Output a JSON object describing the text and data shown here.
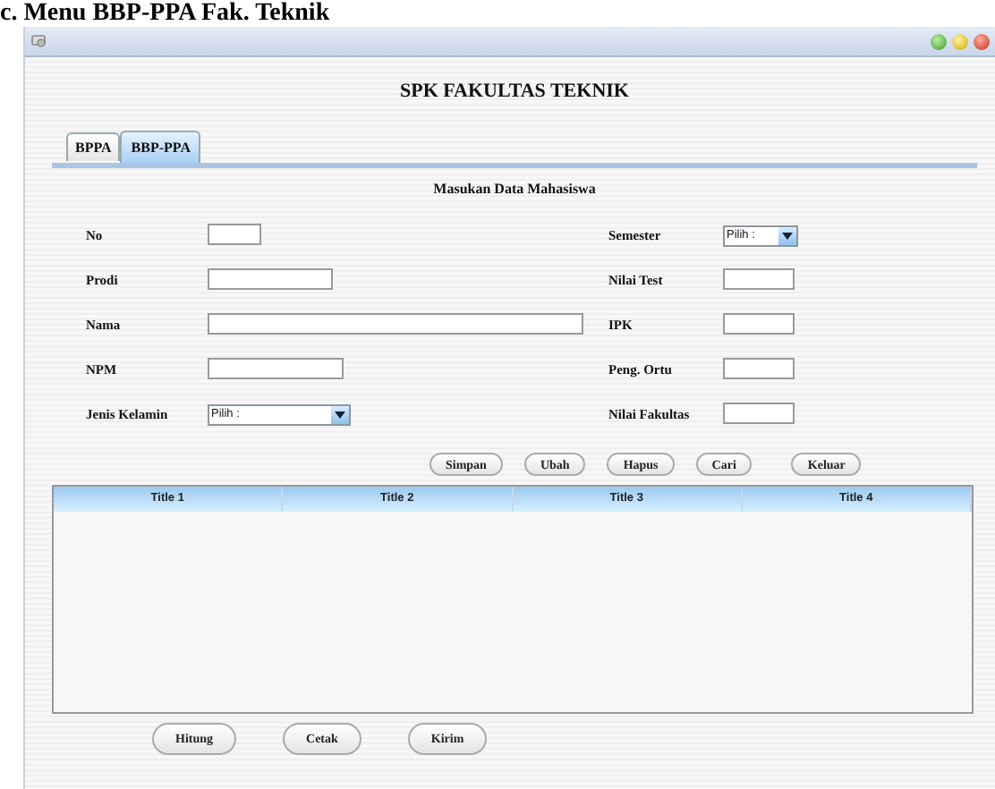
{
  "caption": "c. Menu BBP-PPA Fak. Teknik",
  "window": {
    "title": "SPK FAKULTAS TEKNIK"
  },
  "tabs": [
    {
      "label": "BPPA",
      "selected": false
    },
    {
      "label": "BBP-PPA",
      "selected": true
    }
  ],
  "section_title": "Masukan Data Mahasiswa",
  "fields_left": [
    {
      "label": "No",
      "kind": "text"
    },
    {
      "label": "Prodi",
      "kind": "text"
    },
    {
      "label": "Nama",
      "kind": "text"
    },
    {
      "label": "NPM",
      "kind": "text"
    },
    {
      "label": "Jenis Kelamin",
      "kind": "select",
      "value": "Pilih :"
    }
  ],
  "fields_right": [
    {
      "label": "Semester",
      "kind": "select",
      "value": "Pilih :"
    },
    {
      "label": "Nilai Test",
      "kind": "text"
    },
    {
      "label": "IPK",
      "kind": "text"
    },
    {
      "label": "Peng. Ortu",
      "kind": "text"
    },
    {
      "label": "Nilai Fakultas",
      "kind": "text"
    }
  ],
  "buttons": [
    "Simpan",
    "Ubah",
    "Hapus",
    "Cari",
    "Keluar"
  ],
  "table": {
    "columns": [
      "Title 1",
      "Title 2",
      "Title 3",
      "Title 4"
    ]
  },
  "bottom_buttons": [
    "Hitung",
    "Cetak",
    "Kirim"
  ]
}
